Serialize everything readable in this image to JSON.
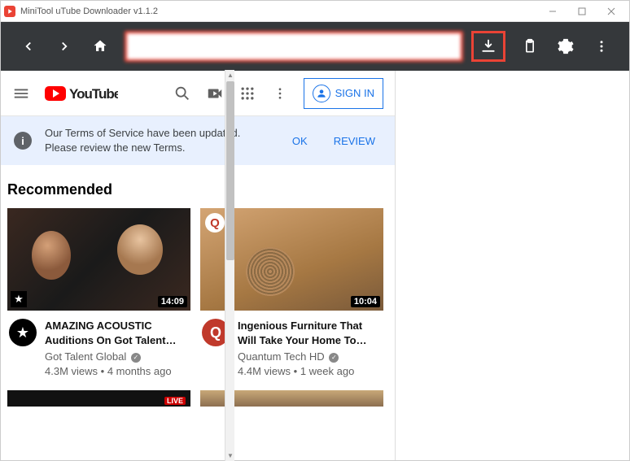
{
  "window": {
    "title": "MiniTool uTube Downloader v1.1.2"
  },
  "toolbar": {
    "url_value": ""
  },
  "youtube": {
    "brand": "YouTube",
    "signin_label": "SIGN IN",
    "tos": {
      "line1": "Our Terms of Service have been updated.",
      "line2": "Please review the new Terms.",
      "ok_label": "OK",
      "review_label": "REVIEW",
      "icon_glyph": "i"
    },
    "recommended_heading": "Recommended",
    "videos": [
      {
        "title": "AMAZING ACOUSTIC Auditions On Got Talent…",
        "channel": "Got Talent Global",
        "views": "4.3M views",
        "age": "4 months ago",
        "duration": "14:09"
      },
      {
        "title": "Ingenious Furniture That Will Take Your Home To…",
        "channel": "Quantum Tech HD",
        "views": "4.4M views",
        "age": "1 week ago",
        "duration": "10:04"
      }
    ],
    "live_badge": "LIVE"
  }
}
